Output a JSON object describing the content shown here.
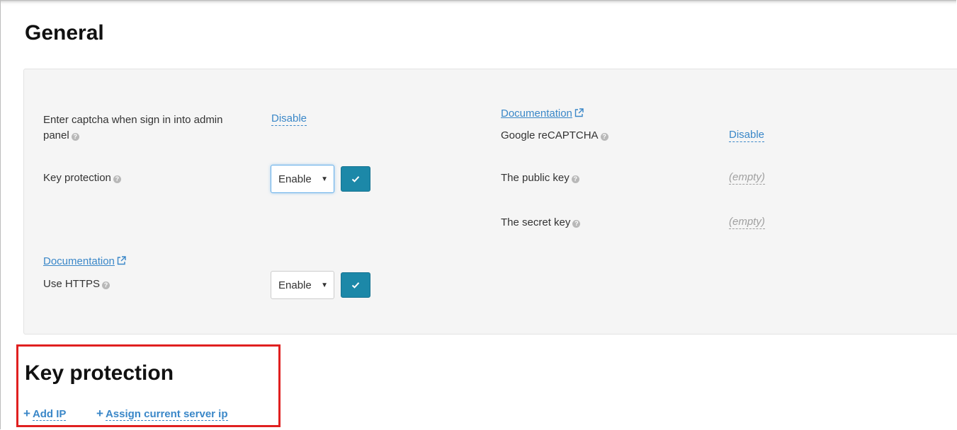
{
  "general": {
    "title": "General"
  },
  "settings_left": {
    "captcha": {
      "label": "Enter captcha when sign in into admin panel",
      "label_line1": "Enter captcha when sign in into admin",
      "label_line2": "panel",
      "value": "Disable"
    },
    "key_protection": {
      "label": "Key protection",
      "select_value": "Enable"
    },
    "https": {
      "doc_link": "Documentation",
      "label": "Use HTTPS",
      "select_value": "Enable"
    }
  },
  "settings_right": {
    "doc_link": "Documentation",
    "recaptcha": {
      "label": "Google reCAPTCHA",
      "value": "Disable"
    },
    "public_key": {
      "label": "The public key",
      "value": "(empty)"
    },
    "secret_key": {
      "label": "The secret key",
      "value": "(empty)"
    }
  },
  "key_protection_section": {
    "title": "Key protection",
    "add_ip": "Add IP",
    "assign_ip": "Assign current server ip"
  },
  "icons": {
    "help": "question-circle-icon",
    "external": "external-link-icon",
    "check": "check-icon",
    "caret": "caret-down-icon",
    "plus": "plus-icon"
  },
  "colors": {
    "link": "#3a87c8",
    "button": "#1c88a8",
    "panel_bg": "#f5f5f5",
    "highlight": "#e02020"
  }
}
